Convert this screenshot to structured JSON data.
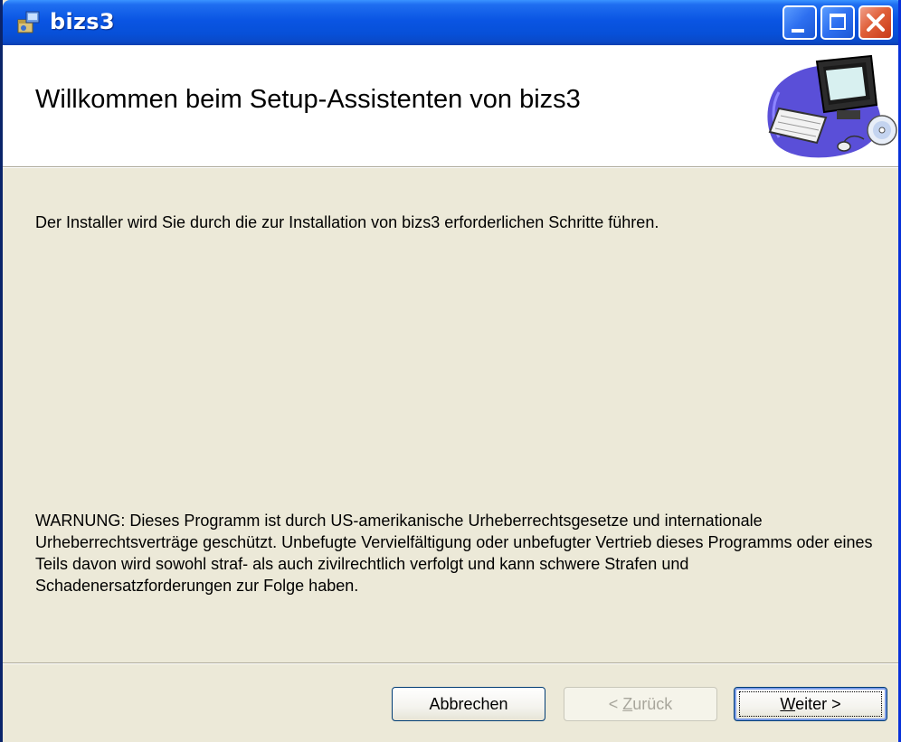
{
  "window": {
    "title": "bizs3",
    "app_icon": "installer-package-icon",
    "controls": {
      "minimize": "minimize-icon",
      "maximize": "maximize-icon",
      "close": "close-icon"
    }
  },
  "header": {
    "title": "Willkommen beim Setup-Assistenten von bizs3",
    "art": "computer-cd-illustration"
  },
  "body": {
    "intro": "Der Installer wird Sie durch die zur Installation von bizs3 erforderlichen Schritte führen.",
    "warning": "WARNUNG: Dieses Programm ist durch US-amerikanische Urheberrechtsgesetze und internationale Urheberrechtsverträge geschützt. Unbefugte Vervielfältigung oder unbefugter Vertrieb dieses Programms oder eines Teils davon wird sowohl straf- als auch zivilrechtlich verfolgt und kann schwere Strafen und Schadenersatzforderungen zur Folge haben."
  },
  "buttons": {
    "cancel": "Abbrechen",
    "back_prefix": "< ",
    "back_accel": "Z",
    "back_rest": "urück",
    "next_accel": "W",
    "next_rest": "eiter >"
  },
  "colors": {
    "titlebar": "#0a55e3",
    "dialog_bg": "#ece9d8",
    "header_bg": "#ffffff",
    "close_button": "#e0603a"
  }
}
